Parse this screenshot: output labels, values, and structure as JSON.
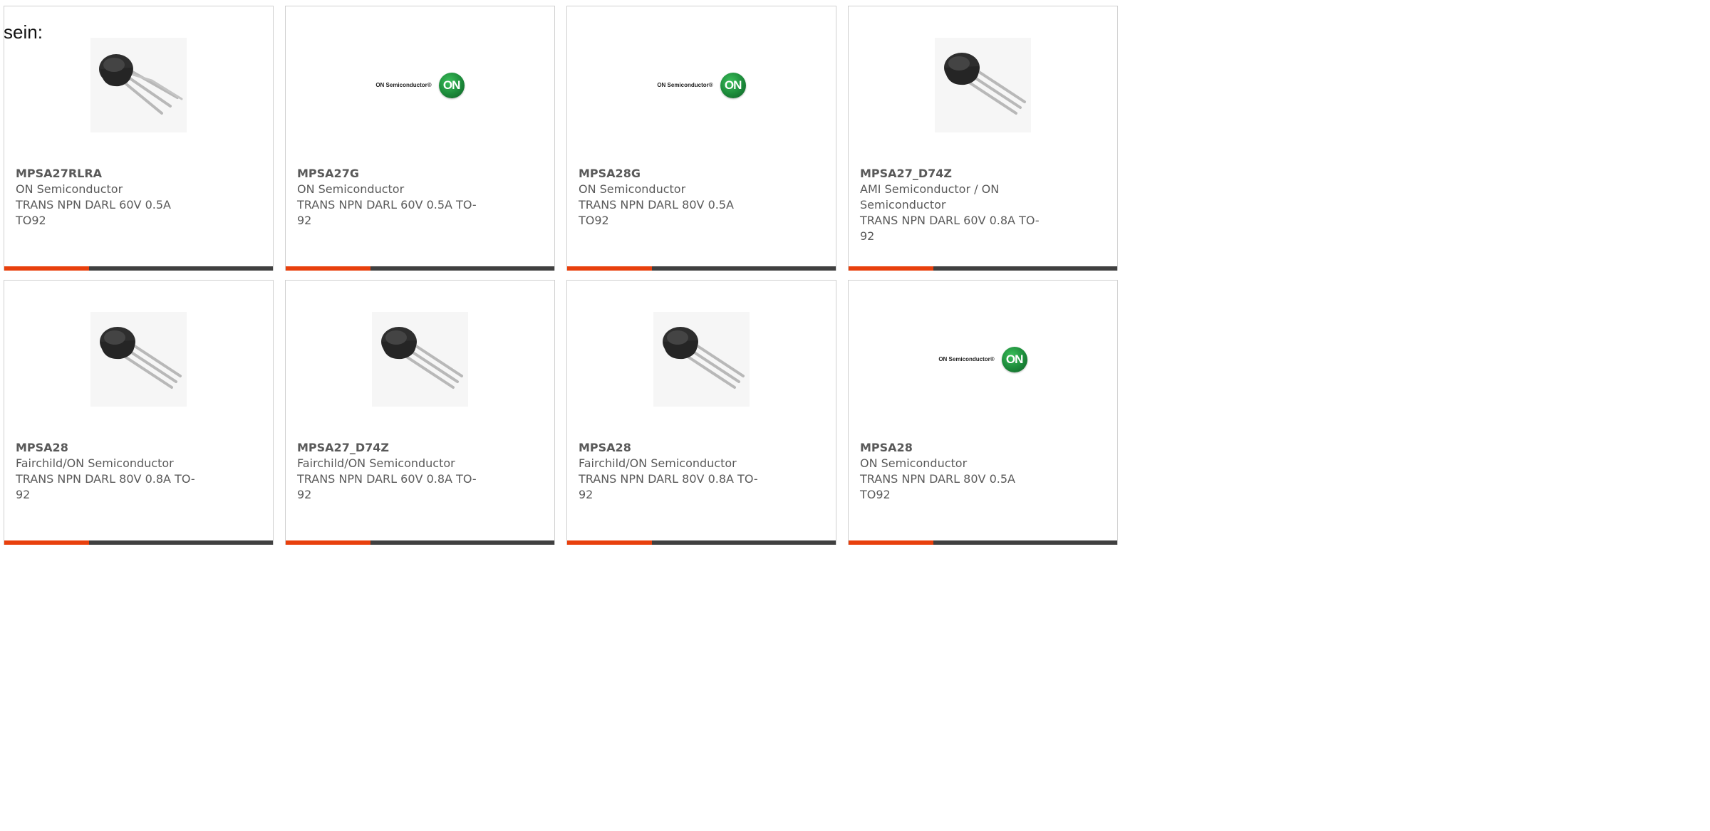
{
  "lead_text": "sein:",
  "colors": {
    "accent": "#e8400d",
    "bar": "#404040",
    "logo_green": "#1c8a3a"
  },
  "cards": [
    {
      "part": "MPSA27RLRA",
      "maker": "ON Semiconductor",
      "desc": "TRANS NPN DARL 60V 0.5A TO92",
      "image": "transistor-angled"
    },
    {
      "part": "MPSA27G",
      "maker": "ON Semiconductor",
      "desc": "TRANS NPN DARL 60V 0.5A TO-92",
      "image": "on-semi-logo",
      "logo_text": "ON Semiconductor®",
      "logo_mark": "ON"
    },
    {
      "part": "MPSA28G",
      "maker": "ON Semiconductor",
      "desc": "TRANS NPN DARL 80V 0.5A TO92",
      "image": "on-semi-logo",
      "logo_text": "ON Semiconductor®",
      "logo_mark": "ON"
    },
    {
      "part": "MPSA27_D74Z",
      "maker": "AMI Semiconductor / ON Semiconductor",
      "desc": "TRANS NPN DARL 60V 0.8A TO-92",
      "image": "transistor"
    },
    {
      "part": "MPSA28",
      "maker": "Fairchild/ON Semiconductor",
      "desc": "TRANS NPN DARL 80V 0.8A TO-92",
      "image": "transistor"
    },
    {
      "part": "MPSA27_D74Z",
      "maker": "Fairchild/ON Semiconductor",
      "desc": "TRANS NPN DARL 60V 0.8A TO-92",
      "image": "transistor"
    },
    {
      "part": "MPSA28",
      "maker": "Fairchild/ON Semiconductor",
      "desc": "TRANS NPN DARL 80V 0.8A TO-92",
      "image": "transistor"
    },
    {
      "part": "MPSA28",
      "maker": "ON Semiconductor",
      "desc": "TRANS NPN DARL 80V 0.5A TO92",
      "image": "on-semi-logo",
      "logo_text": "ON Semiconductor®",
      "logo_mark": "ON"
    }
  ]
}
